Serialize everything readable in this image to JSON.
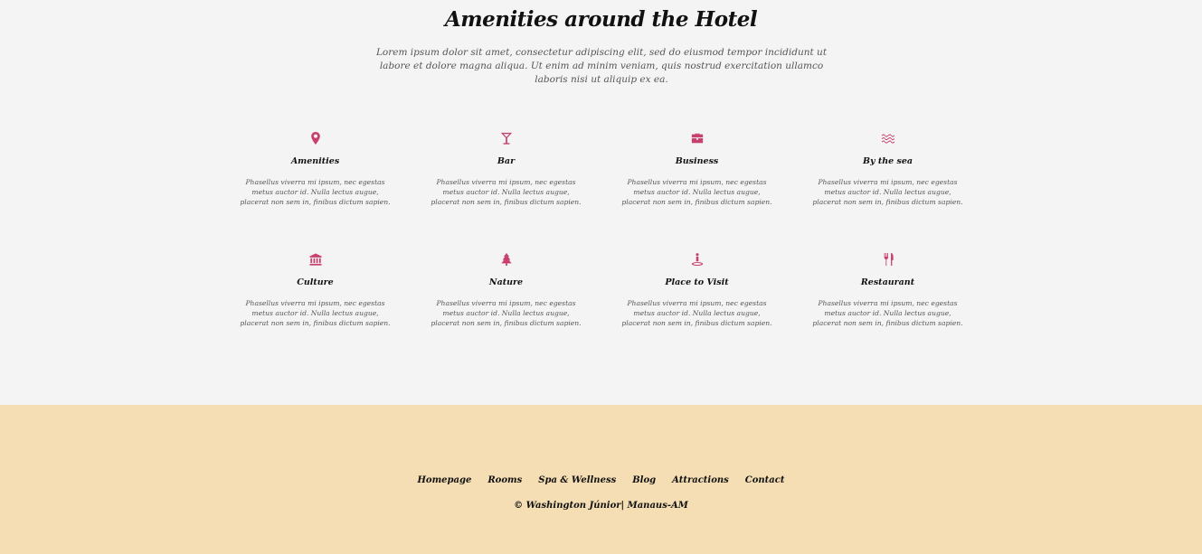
{
  "section": {
    "title": "Amenities around the Hotel",
    "intro": "Lorem ipsum dolor sit amet, consectetur adipiscing elit, sed do eiusmod tempor incididunt ut labore et dolore magna aliqua. Ut enim ad minim veniam, quis nostrud exercitation ullamco laboris nisi ut aliquip ex ea."
  },
  "amenities": [
    {
      "icon": "map-pin-icon",
      "title": "Amenities",
      "text": "Phasellus viverra mi ipsum, nec egestas metus auctor id. Nulla lectus augue, placerat non sem in, finibus dictum sapien."
    },
    {
      "icon": "cocktail-icon",
      "title": "Bar",
      "text": "Phasellus viverra mi ipsum, nec egestas metus auctor id. Nulla lectus augue, placerat non sem in, finibus dictum sapien."
    },
    {
      "icon": "briefcase-icon",
      "title": "Business",
      "text": "Phasellus viverra mi ipsum, nec egestas metus auctor id. Nulla lectus augue, placerat non sem in, finibus dictum sapien."
    },
    {
      "icon": "waves-icon",
      "title": "By the sea",
      "text": "Phasellus viverra mi ipsum, nec egestas metus auctor id. Nulla lectus augue, placerat non sem in, finibus dictum sapien."
    },
    {
      "icon": "museum-icon",
      "title": "Culture",
      "text": "Phasellus viverra mi ipsum, nec egestas metus auctor id. Nulla lectus augue, placerat non sem in, finibus dictum sapien."
    },
    {
      "icon": "tree-icon",
      "title": "Nature",
      "text": "Phasellus viverra mi ipsum, nec egestas metus auctor id. Nulla lectus augue, placerat non sem in, finibus dictum sapien."
    },
    {
      "icon": "person-pin-icon",
      "title": "Place to Visit",
      "text": "Phasellus viverra mi ipsum, nec egestas metus auctor id. Nulla lectus augue, placerat non sem in, finibus dictum sapien."
    },
    {
      "icon": "cutlery-icon",
      "title": "Restaurant",
      "text": "Phasellus viverra mi ipsum, nec egestas metus auctor id. Nulla lectus augue, placerat non sem in, finibus dictum sapien."
    }
  ],
  "footer": {
    "nav": [
      "Homepage",
      "Rooms",
      "Spa & Wellness",
      "Blog",
      "Attractions",
      "Contact"
    ],
    "copyright": "© Washington Júnior| Manaus-AM"
  },
  "colors": {
    "accent": "#c8416c",
    "footer_bg": "#f5deb3",
    "section_bg": "#f4f4f5"
  }
}
